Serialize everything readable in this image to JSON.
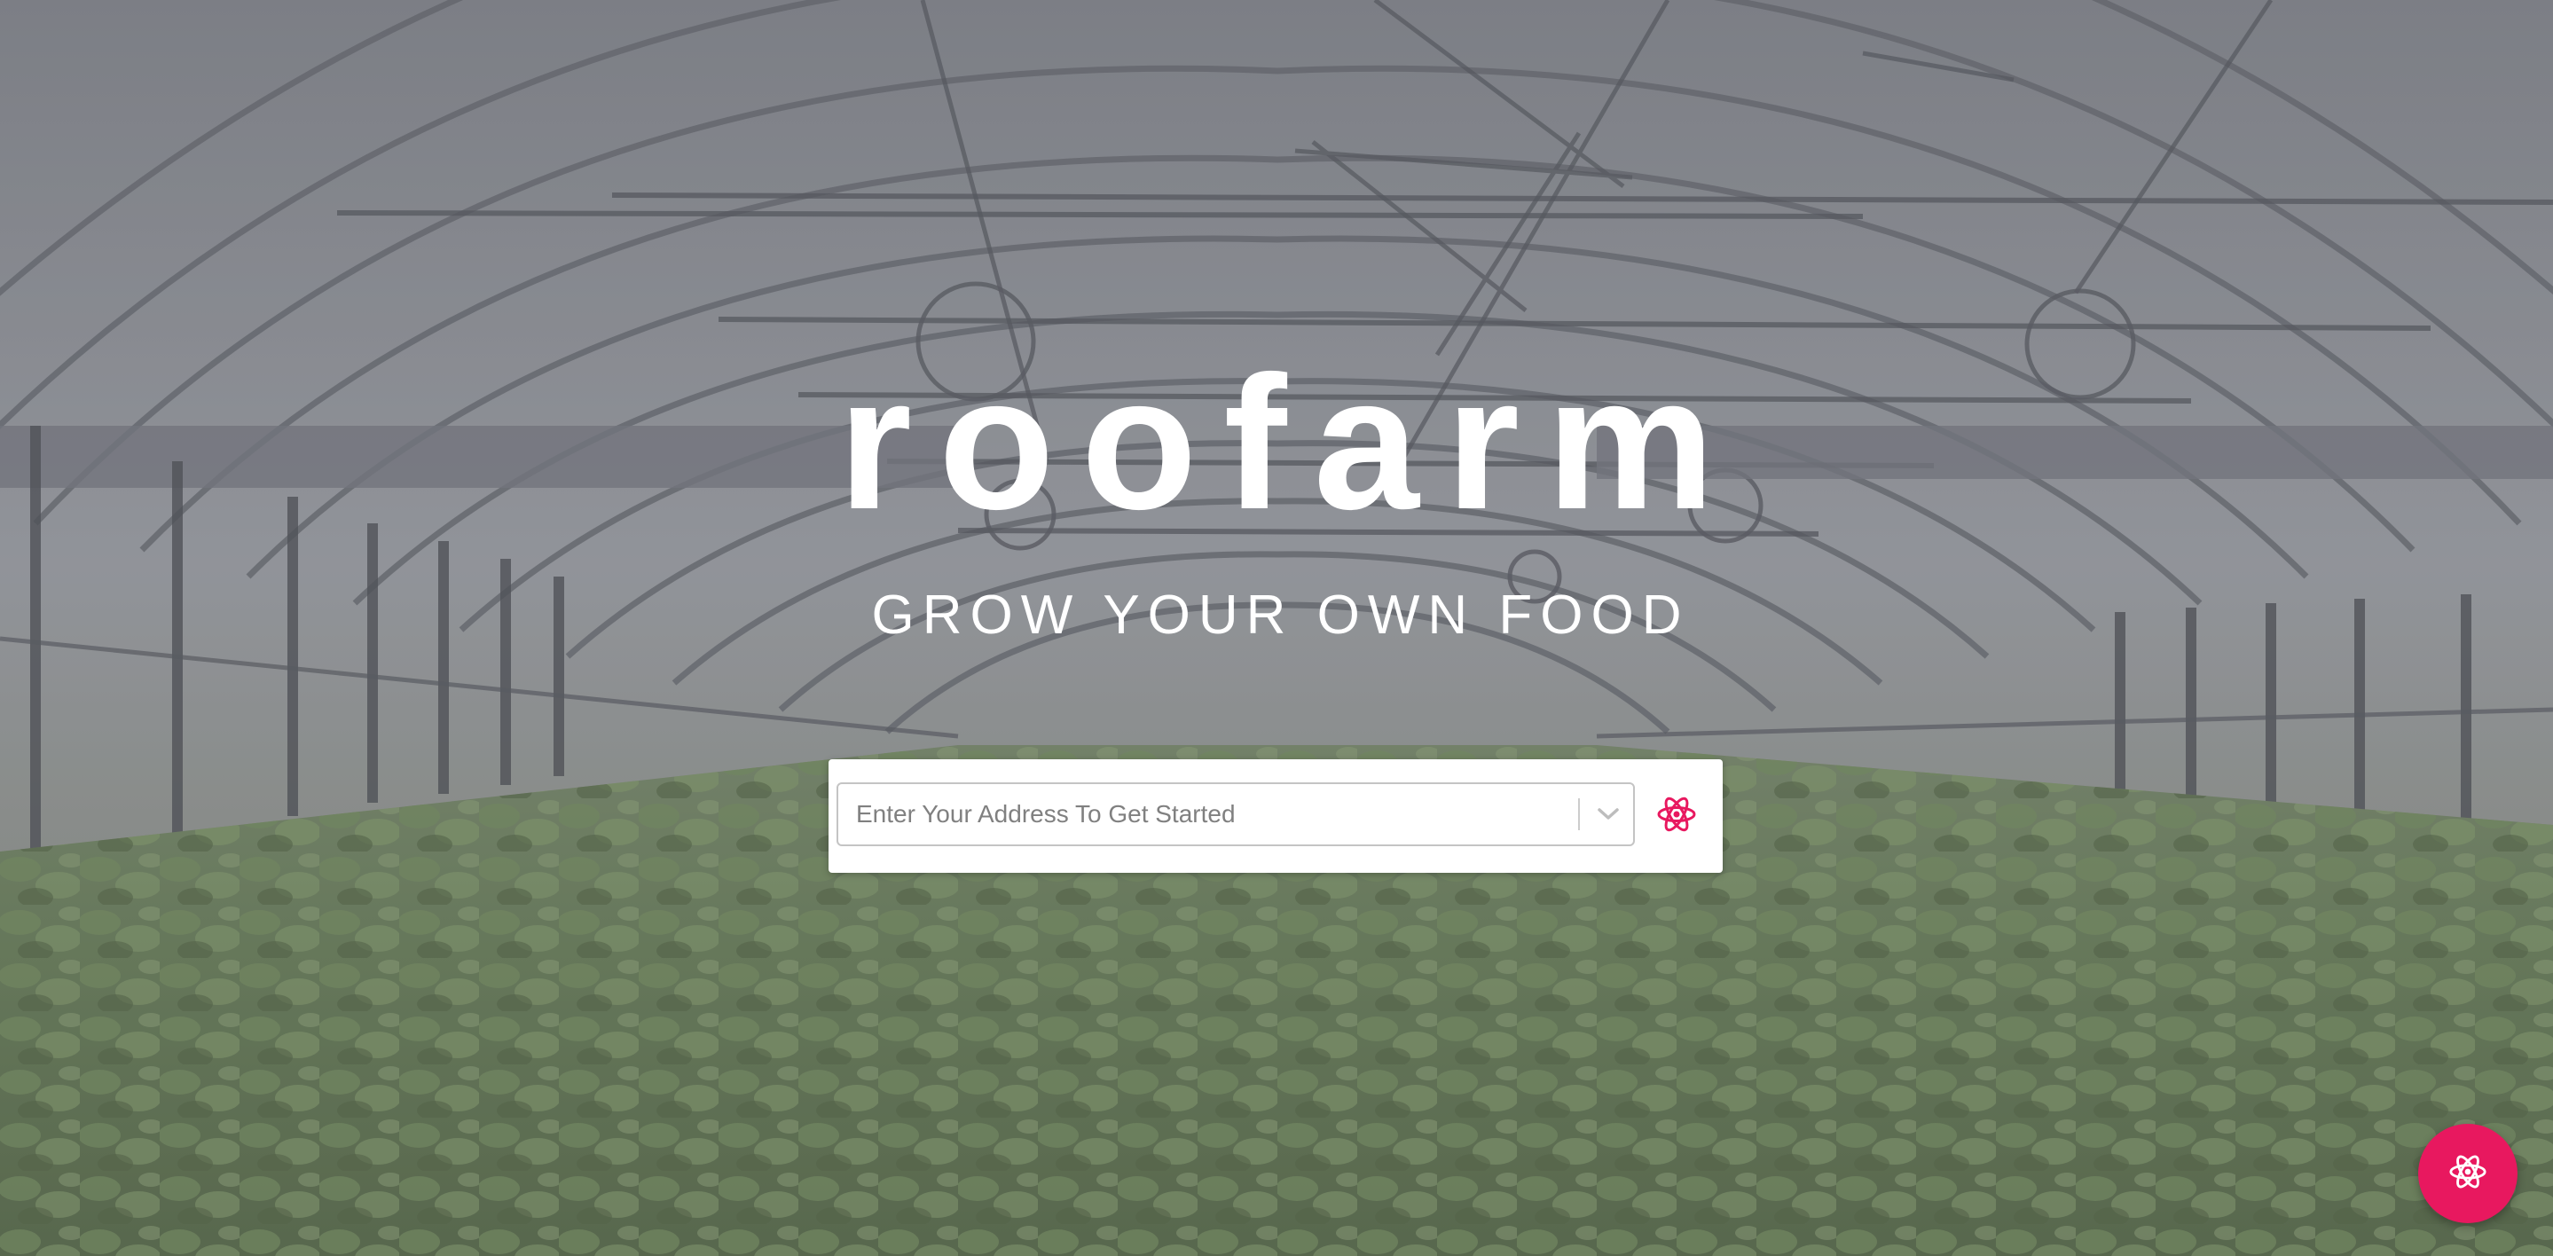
{
  "brand": {
    "name": "roofarm",
    "tagline": "GROW YOUR OWN FOOD"
  },
  "search": {
    "placeholder": "Enter Your Address To Get Started",
    "value": ""
  },
  "icons": {
    "dropdown": "chevron-down-icon",
    "loader": "atom-icon",
    "fab": "atom-icon"
  },
  "colors": {
    "accent": "#e8185f",
    "title_text": "#ffffff",
    "placeholder_text": "#808080",
    "card_background": "#ffffff"
  }
}
